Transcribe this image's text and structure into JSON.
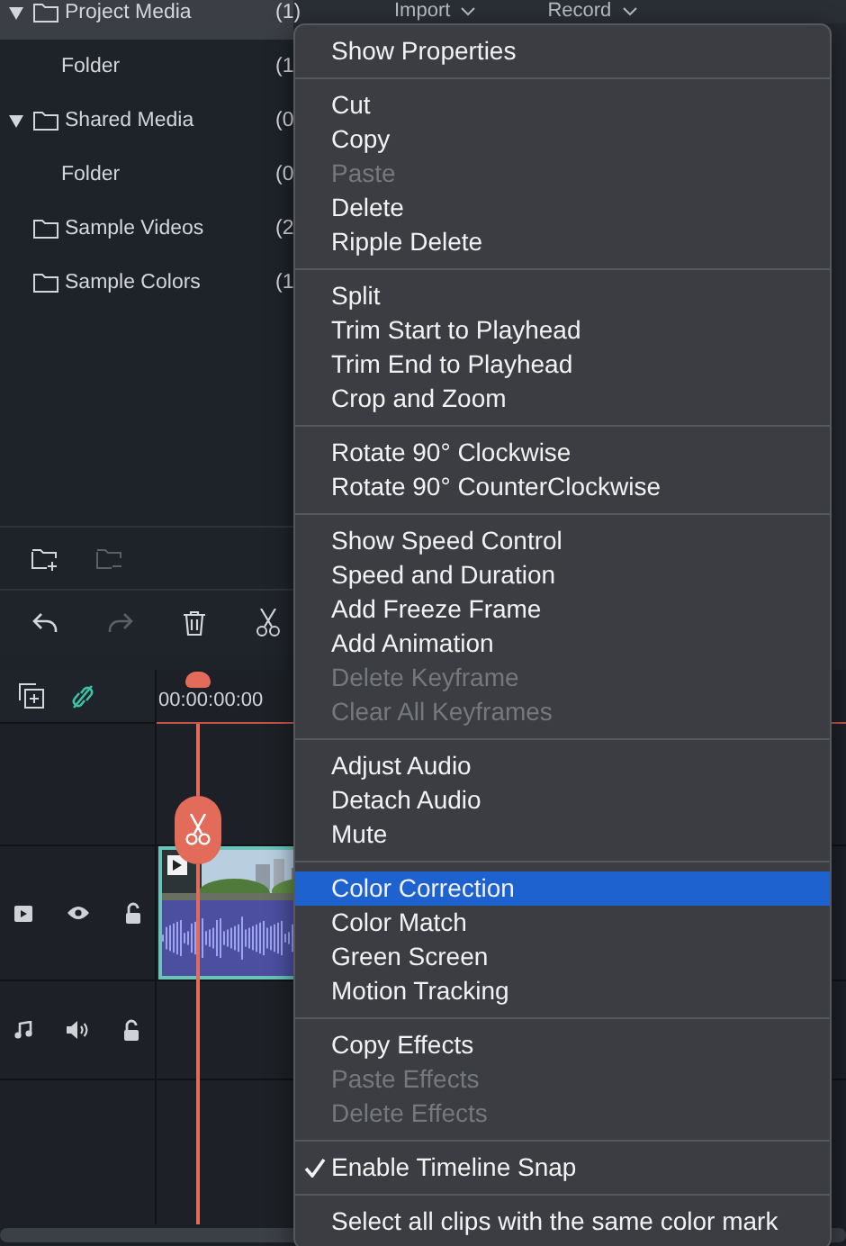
{
  "header_tabs": [
    "Import",
    "Record"
  ],
  "media_tree": [
    {
      "kind": "group",
      "label": "Project Media",
      "count": "(1)",
      "expanded": true,
      "selected": true,
      "children": [
        {
          "kind": "folder",
          "label": "Folder",
          "count": "(1",
          "selected": false
        }
      ]
    },
    {
      "kind": "group",
      "label": "Shared Media",
      "count": "(0",
      "expanded": true,
      "selected": false,
      "children": [
        {
          "kind": "folder",
          "label": "Folder",
          "count": "(0",
          "selected": false
        }
      ]
    },
    {
      "kind": "folder",
      "label": "Sample Videos",
      "count": "(2",
      "selected": false
    },
    {
      "kind": "folder",
      "label": "Sample Colors",
      "count": "(1",
      "selected": false
    }
  ],
  "timeline": {
    "timecode": "00:00:00:00",
    "tracks": [
      {
        "kind": "video",
        "visible": true,
        "locked": false
      },
      {
        "kind": "audio",
        "muted": false,
        "locked": false
      }
    ]
  },
  "context_menu": [
    [
      {
        "label": "Show Properties",
        "disabled": false,
        "checked": false,
        "selected": false
      }
    ],
    [
      {
        "label": "Cut",
        "disabled": false,
        "checked": false,
        "selected": false
      },
      {
        "label": "Copy",
        "disabled": false,
        "checked": false,
        "selected": false
      },
      {
        "label": "Paste",
        "disabled": true,
        "checked": false,
        "selected": false
      },
      {
        "label": "Delete",
        "disabled": false,
        "checked": false,
        "selected": false
      },
      {
        "label": "Ripple Delete",
        "disabled": false,
        "checked": false,
        "selected": false
      }
    ],
    [
      {
        "label": "Split",
        "disabled": false,
        "checked": false,
        "selected": false
      },
      {
        "label": "Trim Start to Playhead",
        "disabled": false,
        "checked": false,
        "selected": false
      },
      {
        "label": "Trim End to Playhead",
        "disabled": false,
        "checked": false,
        "selected": false
      },
      {
        "label": "Crop and Zoom",
        "disabled": false,
        "checked": false,
        "selected": false
      }
    ],
    [
      {
        "label": "Rotate 90° Clockwise",
        "disabled": false,
        "checked": false,
        "selected": false
      },
      {
        "label": "Rotate 90° CounterClockwise",
        "disabled": false,
        "checked": false,
        "selected": false
      }
    ],
    [
      {
        "label": "Show Speed Control",
        "disabled": false,
        "checked": false,
        "selected": false
      },
      {
        "label": "Speed and Duration",
        "disabled": false,
        "checked": false,
        "selected": false
      },
      {
        "label": "Add Freeze Frame",
        "disabled": false,
        "checked": false,
        "selected": false
      },
      {
        "label": "Add Animation",
        "disabled": false,
        "checked": false,
        "selected": false
      },
      {
        "label": "Delete Keyframe",
        "disabled": true,
        "checked": false,
        "selected": false
      },
      {
        "label": "Clear All Keyframes",
        "disabled": true,
        "checked": false,
        "selected": false
      }
    ],
    [
      {
        "label": "Adjust Audio",
        "disabled": false,
        "checked": false,
        "selected": false
      },
      {
        "label": "Detach Audio",
        "disabled": false,
        "checked": false,
        "selected": false
      },
      {
        "label": "Mute",
        "disabled": false,
        "checked": false,
        "selected": false
      }
    ],
    [
      {
        "label": "Color Correction",
        "disabled": false,
        "checked": false,
        "selected": true
      },
      {
        "label": "Color Match",
        "disabled": false,
        "checked": false,
        "selected": false
      },
      {
        "label": "Green Screen",
        "disabled": false,
        "checked": false,
        "selected": false
      },
      {
        "label": "Motion Tracking",
        "disabled": false,
        "checked": false,
        "selected": false
      }
    ],
    [
      {
        "label": "Copy Effects",
        "disabled": false,
        "checked": false,
        "selected": false
      },
      {
        "label": "Paste Effects",
        "disabled": true,
        "checked": false,
        "selected": false
      },
      {
        "label": "Delete Effects",
        "disabled": true,
        "checked": false,
        "selected": false
      }
    ],
    [
      {
        "label": "Enable Timeline Snap",
        "disabled": false,
        "checked": true,
        "selected": false
      }
    ],
    [
      {
        "label": "Select all clips with the same color mark",
        "disabled": false,
        "checked": false,
        "selected": false
      }
    ]
  ]
}
